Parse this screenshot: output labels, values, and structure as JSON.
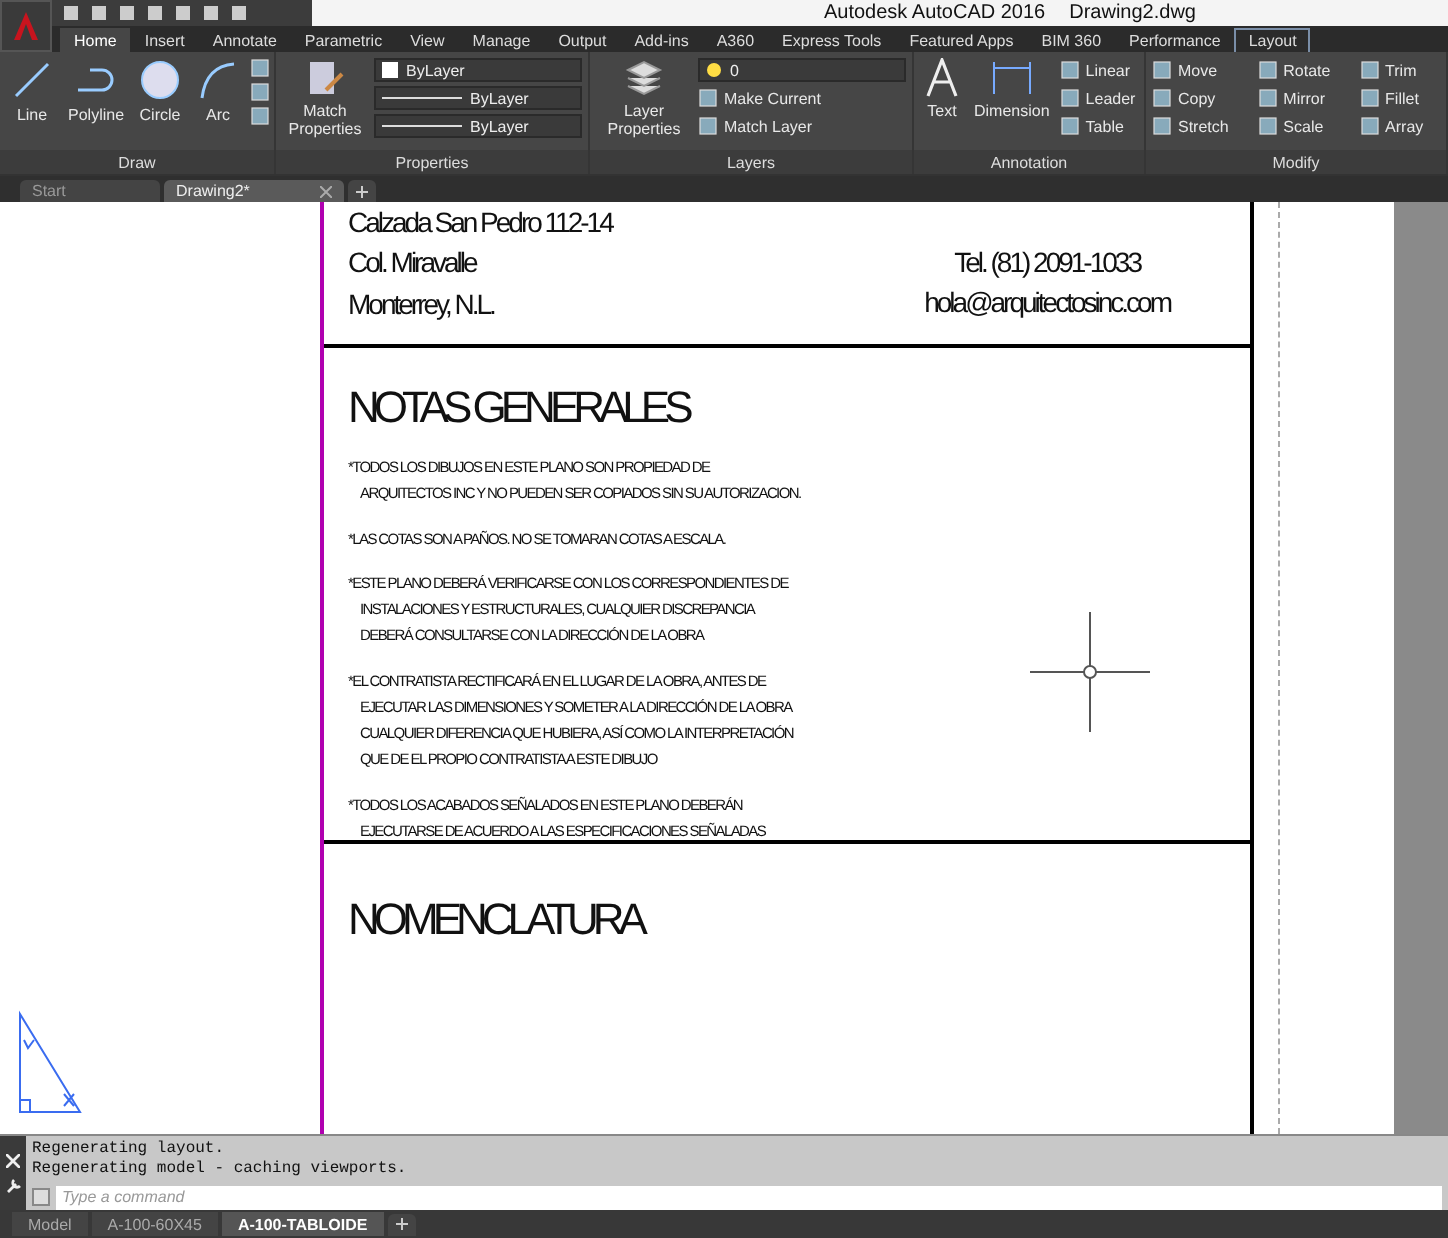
{
  "app": {
    "title": "Autodesk AutoCAD 2016",
    "file": "Drawing2.dwg"
  },
  "ribbon_tabs": [
    {
      "label": "Home",
      "selected": true,
      "contextual": false
    },
    {
      "label": "Insert",
      "selected": false,
      "contextual": false
    },
    {
      "label": "Annotate",
      "selected": false,
      "contextual": false
    },
    {
      "label": "Parametric",
      "selected": false,
      "contextual": false
    },
    {
      "label": "View",
      "selected": false,
      "contextual": false
    },
    {
      "label": "Manage",
      "selected": false,
      "contextual": false
    },
    {
      "label": "Output",
      "selected": false,
      "contextual": false
    },
    {
      "label": "Add-ins",
      "selected": false,
      "contextual": false
    },
    {
      "label": "A360",
      "selected": false,
      "contextual": false
    },
    {
      "label": "Express Tools",
      "selected": false,
      "contextual": false
    },
    {
      "label": "Featured Apps",
      "selected": false,
      "contextual": false
    },
    {
      "label": "BIM 360",
      "selected": false,
      "contextual": false
    },
    {
      "label": "Performance",
      "selected": false,
      "contextual": false
    },
    {
      "label": "Layout",
      "selected": false,
      "contextual": true
    }
  ],
  "panels": {
    "draw": {
      "label": "Draw",
      "large": [
        "Line",
        "Polyline",
        "Circle",
        "Arc"
      ]
    },
    "properties": {
      "label": "Properties",
      "match": "Match Properties",
      "dropdowns": [
        "ByLayer",
        "ByLayer",
        "ByLayer"
      ]
    },
    "layers": {
      "label": "Layers",
      "large": "Layer Properties",
      "layer": "0",
      "small": [
        "Make Current",
        "Match Layer"
      ]
    },
    "annotation": {
      "label": "Annotation",
      "large": [
        "Text",
        "Dimension"
      ],
      "small": [
        "Linear",
        "Leader",
        "Table"
      ]
    },
    "modify": {
      "label": "Modify",
      "small": [
        "Move",
        "Rotate",
        "Trim",
        "Copy",
        "Mirror",
        "Fillet",
        "Stretch",
        "Scale",
        "Array"
      ]
    }
  },
  "doc_tabs": [
    {
      "label": "Start",
      "selected": false
    },
    {
      "label": "Drawing2*",
      "selected": true
    }
  ],
  "sheet": {
    "address": [
      "Calzada San Pedro 112-14",
      "Col. Miravalle",
      "Monterrey, N.L."
    ],
    "contact": [
      "Tel. (81) 2091-1033",
      "hola@arquitectosinc.com"
    ],
    "notes_title": "NOTAS GENERALES",
    "notes": [
      [
        "*TODOS LOS DIBUJOS EN ESTE PLANO SON PROPIEDAD DE",
        "ARQUITECTOS INC Y NO PUEDEN SER COPIADOS SIN SU AUTORIZACION."
      ],
      [
        "*LAS COTAS SON A PAÑOS. NO SE TOMARAN COTAS A ESCALA."
      ],
      [
        "*ESTE PLANO DEBERÁ VERIFICARSE CON LOS CORRESPONDIENTES DE",
        "INSTALACIONES Y ESTRUCTURALES, CUALQUIER DISCREPANCIA",
        "DEBERÁ CONSULTARSE CON LA DIRECCIÓN DE LA OBRA"
      ],
      [
        "*EL CONTRATISTA RECTIFICARÁ EN EL LUGAR DE LA OBRA, ANTES DE",
        "EJECUTAR LAS DIMENSIONES Y SOMETER A LA DIRECCIÓN DE LA OBRA",
        "CUALQUIER DIFERENCIA QUE HUBIERA, ASÍ COMO LA INTERPRETACIÓN",
        "QUE DE EL PROPIO CONTRATISTA A ESTE DIBUJO"
      ],
      [
        "*TODOS LOS ACABADOS SEÑALADOS EN ESTE PLANO DEBERÁN",
        "EJECUTARSE DE ACUERDO A LAS ESPECIFICACIONES SEÑALADAS"
      ]
    ],
    "nomenclature_title": "NOMENCLATURA"
  },
  "command": {
    "history": [
      "Regenerating layout.",
      "Regenerating model - caching viewports."
    ],
    "placeholder": "Type a command"
  },
  "layout_tabs": [
    {
      "label": "Model",
      "selected": false
    },
    {
      "label": "A-100-60X45",
      "selected": false
    },
    {
      "label": "A-100-TABLOIDE",
      "selected": true
    }
  ]
}
